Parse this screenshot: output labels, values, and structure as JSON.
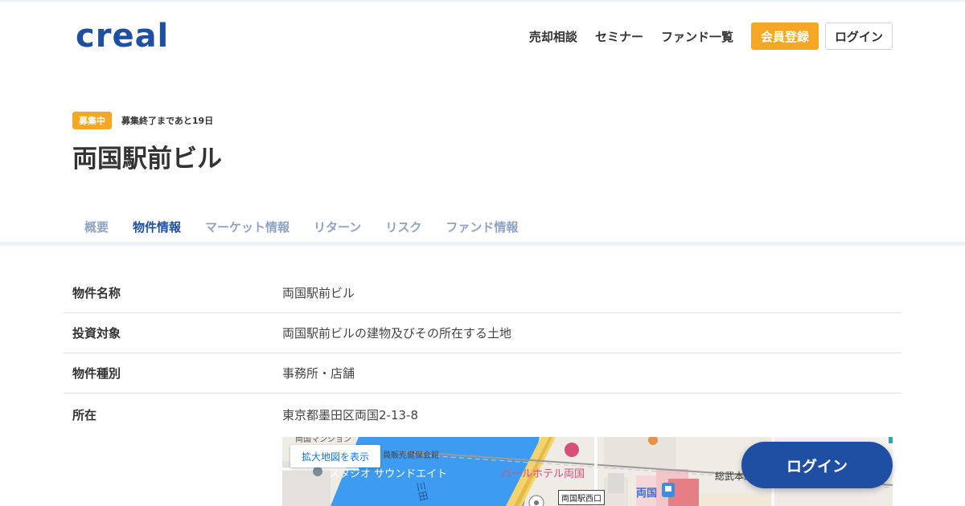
{
  "header": {
    "logo": "creal",
    "nav": [
      "売却相談",
      "セミナー",
      "ファンド一覧"
    ],
    "register_label": "会員登録",
    "login_label": "ログイン"
  },
  "status": {
    "badge": "募集中",
    "remaining": "募集終了まであと19日"
  },
  "title": "両国駅前ビル",
  "tabs": [
    {
      "label": "概要",
      "active": false
    },
    {
      "label": "物件情報",
      "active": true
    },
    {
      "label": "マーケット情報",
      "active": false
    },
    {
      "label": "リターン",
      "active": false
    },
    {
      "label": "リスク",
      "active": false
    },
    {
      "label": "ファンド情報",
      "active": false
    }
  ],
  "info": [
    {
      "label": "物件名称",
      "value": "両国駅前ビル"
    },
    {
      "label": "投資対象",
      "value": "両国駅前ビルの建物及びその所在する土地"
    },
    {
      "label": "物件種別",
      "value": "事務所・店舗"
    },
    {
      "label": "所在",
      "value": "東京都墨田区両国2-13-8"
    }
  ],
  "map": {
    "enlarge_label": "拡大地図を表示",
    "labels": {
      "mansion": "両国マンション",
      "hall": "員販売健保会館",
      "studio": "スタジオ サウンドエイト",
      "hotel": "パールホテル両国",
      "station": "両国",
      "west_exit": "両国駅西口",
      "line": "総武本線",
      "river": "三田"
    }
  },
  "float_login_label": "ログイン",
  "colors": {
    "brand": "#1f4fa3",
    "accent": "#f5a623",
    "tab_inactive": "#8fa3c2"
  }
}
